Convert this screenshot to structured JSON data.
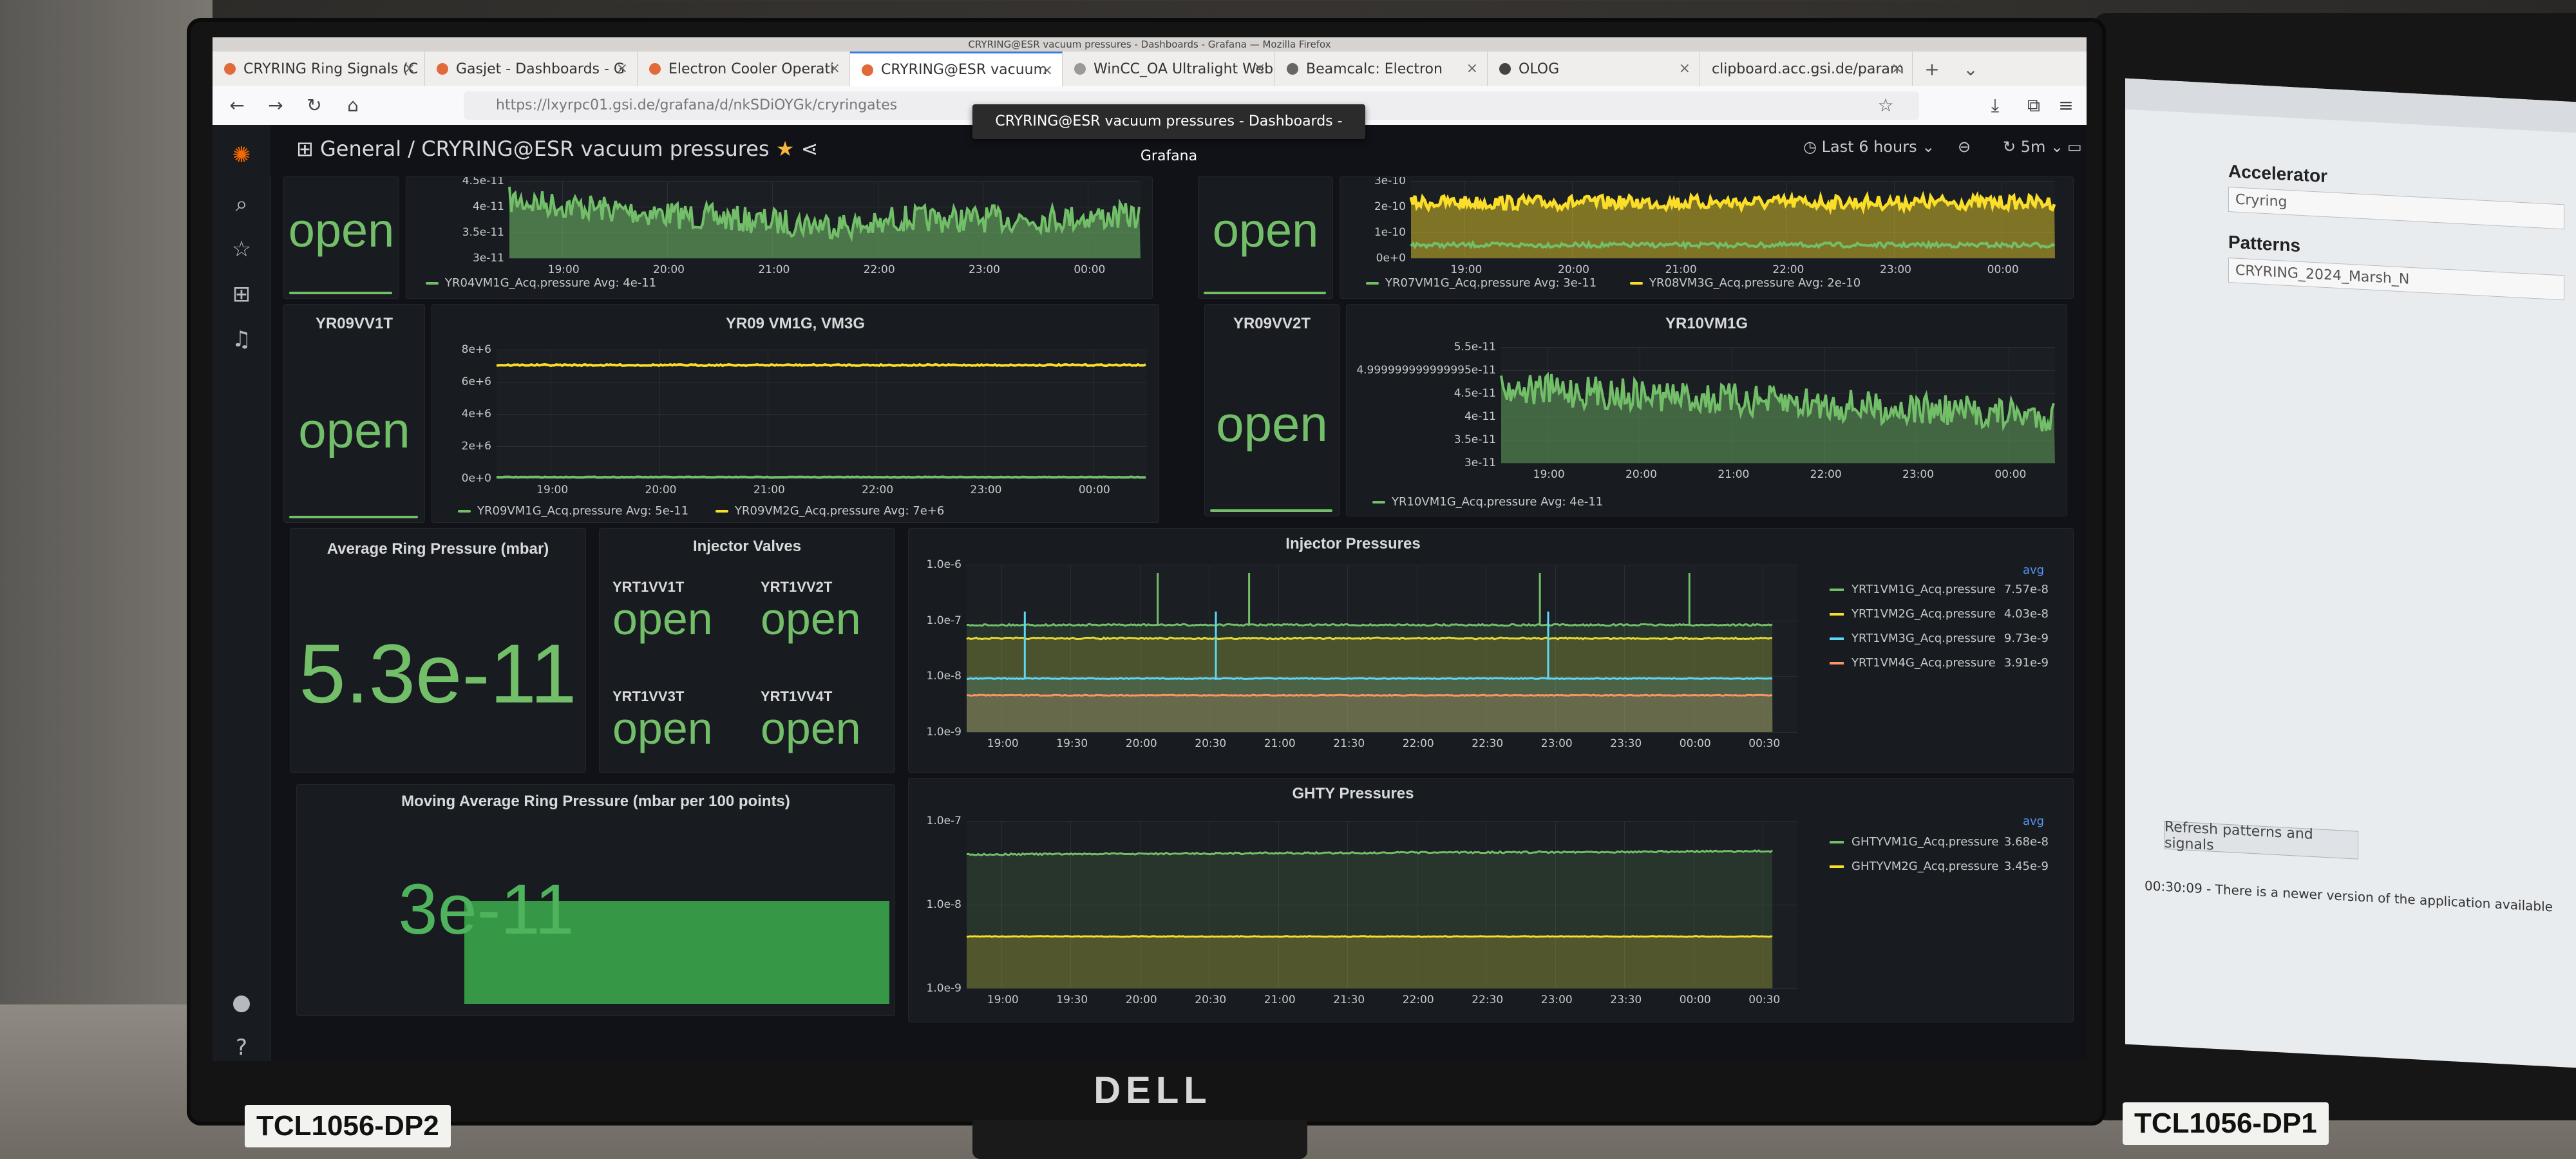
{
  "browser": {
    "window_title": "CRYRING@ESR vacuum pressures - Dashboards - Grafana — Mozilla Firefox",
    "tabs": [
      {
        "label": "CRYRING Ring Signals (C"
      },
      {
        "label": "Gasjet - Dashboards - G"
      },
      {
        "label": "Electron Cooler Operati"
      },
      {
        "label": "CRYRING@ESR vacuum"
      },
      {
        "label": "WinCC_OA Ultralight Web C"
      },
      {
        "label": "Beamcalc: Electron"
      },
      {
        "label": "OLOG"
      },
      {
        "label": "clipboard.acc.gsi.de/param"
      }
    ],
    "url": "https://lxyrpc01.gsi.de/grafana/d/nkSDiOYGk/cryringates",
    "tooltip": "CRYRING@ESR vacuum pressures - Dashboards - Grafana"
  },
  "dashboard": {
    "breadcrumb": "General / CRYRING@ESR vacuum pressures",
    "time_range": "Last 6 hours",
    "refresh": "5m"
  },
  "panels": {
    "yr04_stat": {
      "value": "open"
    },
    "yr04_graph": {
      "yticks": [
        "4.5e-11",
        "4e-11",
        "3.5e-11",
        "3e-11"
      ],
      "xticks": [
        "19:00",
        "20:00",
        "21:00",
        "22:00",
        "23:00",
        "00:00"
      ],
      "legend": "YR04VM1G_Acq.pressure  Avg: 4e-11"
    },
    "yr07_stat": {
      "value": "open"
    },
    "yr07_graph": {
      "yticks": [
        "3e-10",
        "2e-10",
        "1e-10",
        "0e+0"
      ],
      "xticks": [
        "19:00",
        "20:00",
        "21:00",
        "22:00",
        "23:00",
        "00:00"
      ],
      "legend1": "YR07VM1G_Acq.pressure  Avg: 3e-11",
      "legend2": "YR08VM3G_Acq.pressure  Avg: 2e-10"
    },
    "yr09vv1t": {
      "title": "YR09VV1T",
      "value": "open"
    },
    "yr09_graph": {
      "title": "YR09 VM1G, VM3G",
      "yticks": [
        "8e+6",
        "6e+6",
        "4e+6",
        "2e+6",
        "0e+0"
      ],
      "xticks": [
        "19:00",
        "20:00",
        "21:00",
        "22:00",
        "23:00",
        "00:00"
      ],
      "legend1": "YR09VM1G_Acq.pressure  Avg: 5e-11",
      "legend2": "YR09VM2G_Acq.pressure  Avg: 7e+6"
    },
    "yr09vv2t": {
      "title": "YR09VV2T",
      "value": "open"
    },
    "yr10_graph": {
      "title": "YR10VM1G",
      "yticks": [
        "5.5e-11",
        "4.999999999999995e-11",
        "4.5e-11",
        "4e-11",
        "3.5e-11",
        "3e-11"
      ],
      "xticks": [
        "19:00",
        "20:00",
        "21:00",
        "22:00",
        "23:00",
        "00:00"
      ],
      "legend": "YR10VM1G_Acq.pressure  Avg: 4e-11"
    },
    "avg_ring": {
      "title": "Average Ring Pressure (mbar)",
      "value": "5.3e-11"
    },
    "injector_valves": {
      "title": "Injector Valves",
      "valves": [
        {
          "name": "YRT1VV1T",
          "state": "open"
        },
        {
          "name": "YRT1VV2T",
          "state": "open"
        },
        {
          "name": "YRT1VV3T",
          "state": "open"
        },
        {
          "name": "YRT1VV4T",
          "state": "open"
        }
      ]
    },
    "injector_pressures": {
      "title": "Injector Pressures",
      "yticks": [
        "1.0e-6",
        "1.0e-7",
        "1.0e-8",
        "1.0e-9"
      ],
      "xticks": [
        "19:00",
        "19:30",
        "20:00",
        "20:30",
        "21:00",
        "21:30",
        "22:00",
        "22:30",
        "23:00",
        "23:30",
        "00:00",
        "00:30"
      ],
      "avg_header": "avg",
      "series": [
        {
          "name": "YRT1VM1G_Acq.pressure",
          "avg": "7.57e-8",
          "color": "#73bf69"
        },
        {
          "name": "YRT1VM2G_Acq.pressure",
          "avg": "4.03e-8",
          "color": "#fade2a"
        },
        {
          "name": "YRT1VM3G_Acq.pressure",
          "avg": "9.73e-9",
          "color": "#5ed8f5"
        },
        {
          "name": "YRT1VM4G_Acq.pressure",
          "avg": "3.91e-9",
          "color": "#ff9366"
        }
      ]
    },
    "moving_avg": {
      "title": "Moving Average Ring Pressure (mbar per 100 points)",
      "value": "3e-11"
    },
    "ghty": {
      "title": "GHTY Pressures",
      "yticks": [
        "1.0e-7",
        "1.0e-8",
        "1.0e-9"
      ],
      "xticks": [
        "19:00",
        "19:30",
        "20:00",
        "20:30",
        "21:00",
        "21:30",
        "22:00",
        "22:30",
        "23:00",
        "23:30",
        "00:00",
        "00:30"
      ],
      "avg_header": "avg",
      "series": [
        {
          "name": "GHTYVM1G_Acq.pressure",
          "avg": "3.68e-8",
          "color": "#73bf69"
        },
        {
          "name": "GHTYVM2G_Acq.pressure",
          "avg": "3.45e-9",
          "color": "#fade2a"
        }
      ]
    }
  },
  "side_app": {
    "accelerator_label": "Accelerator",
    "accelerator_value": "Cryring",
    "patterns_label": "Patterns",
    "pattern_value": "CRYRING_2024_Marsh_N",
    "refresh_button": "Refresh patterns and signals",
    "status": "00:30:09 - There is a newer version of the application available"
  },
  "hardware": {
    "brand": "DELL",
    "tag_left": "TCL1056-DP2",
    "tag_right": "TCL1056-DP1"
  },
  "colors": {
    "green": "#73bf69",
    "yellow": "#fade2a",
    "cyan": "#5ed8f5",
    "orange": "#ff9366"
  }
}
